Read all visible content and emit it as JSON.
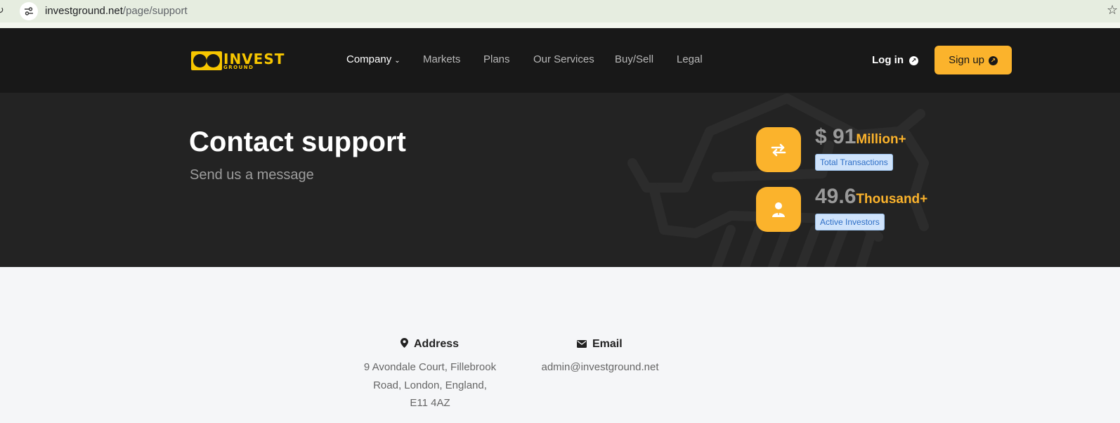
{
  "browser": {
    "url_domain": "investground.net",
    "url_path": "/page/support"
  },
  "brand": {
    "logo_word": "INVEST",
    "logo_sub": "GROUND",
    "color_primary": "#fbb32c",
    "color_logo": "#f7c600"
  },
  "nav": {
    "items": [
      {
        "label": "Company"
      },
      {
        "label": "Markets"
      },
      {
        "label": "Plans"
      },
      {
        "label": "Our Services"
      },
      {
        "label": "Buy/Sell"
      },
      {
        "label": "Legal"
      }
    ],
    "login_label": "Log in",
    "signup_label": "Sign up"
  },
  "hero": {
    "title": "Contact support",
    "subtitle": "Send us a message",
    "stats": [
      {
        "value": "$ 91",
        "unit": "Million+",
        "label": "Total Transactions",
        "icon": "exchange-arrows-icon"
      },
      {
        "value": "49.6",
        "unit": "Thousand+",
        "label": "Active Investors",
        "icon": "investor-user-icon"
      }
    ]
  },
  "contact": {
    "address_label": "Address",
    "address_lines": [
      "9 Avondale Court, Fillebrook",
      "Road, London, England,",
      "E11 4AZ"
    ],
    "email_label": "Email",
    "email_value": "admin@investground.net"
  }
}
